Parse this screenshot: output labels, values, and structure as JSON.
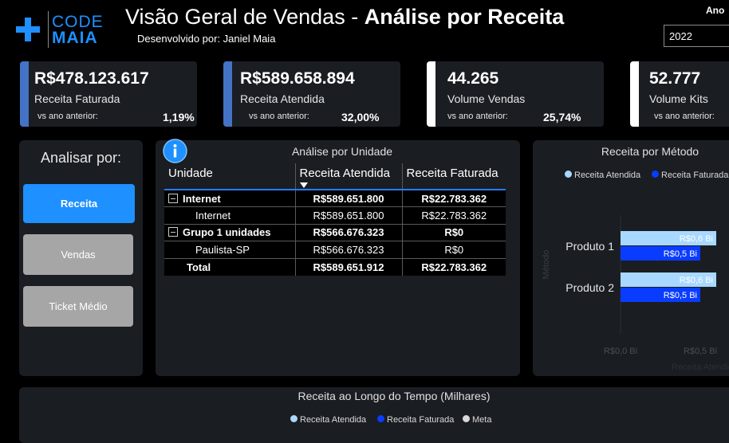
{
  "header": {
    "logo_top": "CODE",
    "logo_bottom": "MAIA",
    "title_regular": "Visão Geral de Vendas - ",
    "title_bold": "Análise por Receita",
    "subtitle": "Desenvolvido por: Janiel Maia",
    "year_label": "Ano",
    "year_value": "2022"
  },
  "kpis": [
    {
      "value": "R$478.123.617",
      "label": "Receita Faturada",
      "vs_label": "vs ano anterior:",
      "pct": "1,19%",
      "accent": "#4472c4"
    },
    {
      "value": "R$589.658.894",
      "label": "Receita Atendida",
      "vs_label": "vs ano anterior:",
      "pct": "32,00%",
      "accent": "#4472c4"
    },
    {
      "value": "44.265",
      "label": "Volume Vendas",
      "vs_label": "vs ano anterior:",
      "pct": "25,74%",
      "accent": "#ffffff"
    },
    {
      "value": "52.777",
      "label": "Volume Kits",
      "vs_label": "vs ano anterior:",
      "pct": "",
      "accent": "#ffffff"
    }
  ],
  "analisar": {
    "title": "Analisar por:",
    "buttons": [
      "Receita",
      "Vendas",
      "Ticket Médio"
    ],
    "active_color": "#1e90ff",
    "inactive_color": "#a6a6a6"
  },
  "unit_table": {
    "title": "Análise por Unidade",
    "columns": [
      "Unidade",
      "Receita Atendida",
      "Receita Faturada"
    ],
    "rows": [
      {
        "unidade": "Internet",
        "atendida": "R$589.651.800",
        "faturada": "R$22.783.362"
      },
      {
        "unidade": "Internet",
        "atendida": "R$589.651.800",
        "faturada": "R$22.783.362"
      },
      {
        "unidade": "Grupo 1 unidades",
        "atendida": "R$566.676.323",
        "faturada": "R$0"
      },
      {
        "unidade": "Paulista-SP",
        "atendida": "R$566.676.323",
        "faturada": "R$0"
      },
      {
        "unidade": "Total",
        "atendida": "R$589.651.912",
        "faturada": "R$22.783.362"
      }
    ]
  },
  "method_chart": {
    "title": "Receita por Método",
    "legend": [
      "Receita Atendida",
      "Receita Faturada"
    ],
    "colors": [
      "#a8d8ff",
      "#0a3cff"
    ],
    "y_axis_label": "Método",
    "x_axis_label": "Receita Atendida e ...",
    "x_ticks": [
      "R$0,0 Bi",
      "R$0,5 Bi"
    ]
  },
  "time_chart": {
    "title": "Receita ao Longo do Tempo (Milhares)",
    "legend": [
      "Receita Atendida",
      "Receita Faturada",
      "Meta"
    ],
    "colors": [
      "#a8d8ff",
      "#0a3cff",
      "#d9d9d9"
    ]
  },
  "chart_data": {
    "type": "bar",
    "title": "Receita por Método",
    "categories": [
      "Produto 1",
      "Produto 2"
    ],
    "series": [
      {
        "name": "Receita Atendida",
        "values": [
          0.6,
          0.6
        ],
        "labels": [
          "R$0,6 Bi",
          "R$0,6 Bi"
        ]
      },
      {
        "name": "Receita Faturada",
        "values": [
          0.5,
          0.5
        ],
        "labels": [
          "R$0,5 Bi",
          "R$0,5 Bi"
        ]
      }
    ],
    "xlim": [
      0,
      0.6
    ],
    "orientation": "horizontal",
    "grid": false,
    "legend_position": "top"
  }
}
